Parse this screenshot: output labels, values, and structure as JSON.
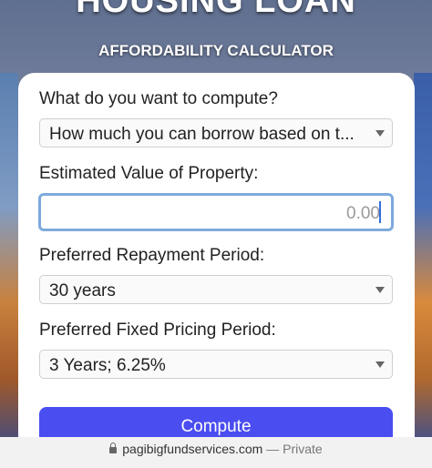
{
  "header": {
    "title": "HOUSING LOAN",
    "subtitle": "AFFORDABILITY CALCULATOR"
  },
  "form": {
    "compute_label": "What do you want to compute?",
    "compute_value": "How much you can borrow based on t...",
    "property_label": "Estimated Value of Property:",
    "property_placeholder": "0.00",
    "repayment_label": "Preferred Repayment Period:",
    "repayment_value": "30 years",
    "pricing_label": "Preferred Fixed Pricing Period:",
    "pricing_value": "3 Years; 6.25%",
    "compute_button": "Compute"
  },
  "browser": {
    "url": "pagibigfundservices.com",
    "separator": "—",
    "mode": "Private"
  }
}
